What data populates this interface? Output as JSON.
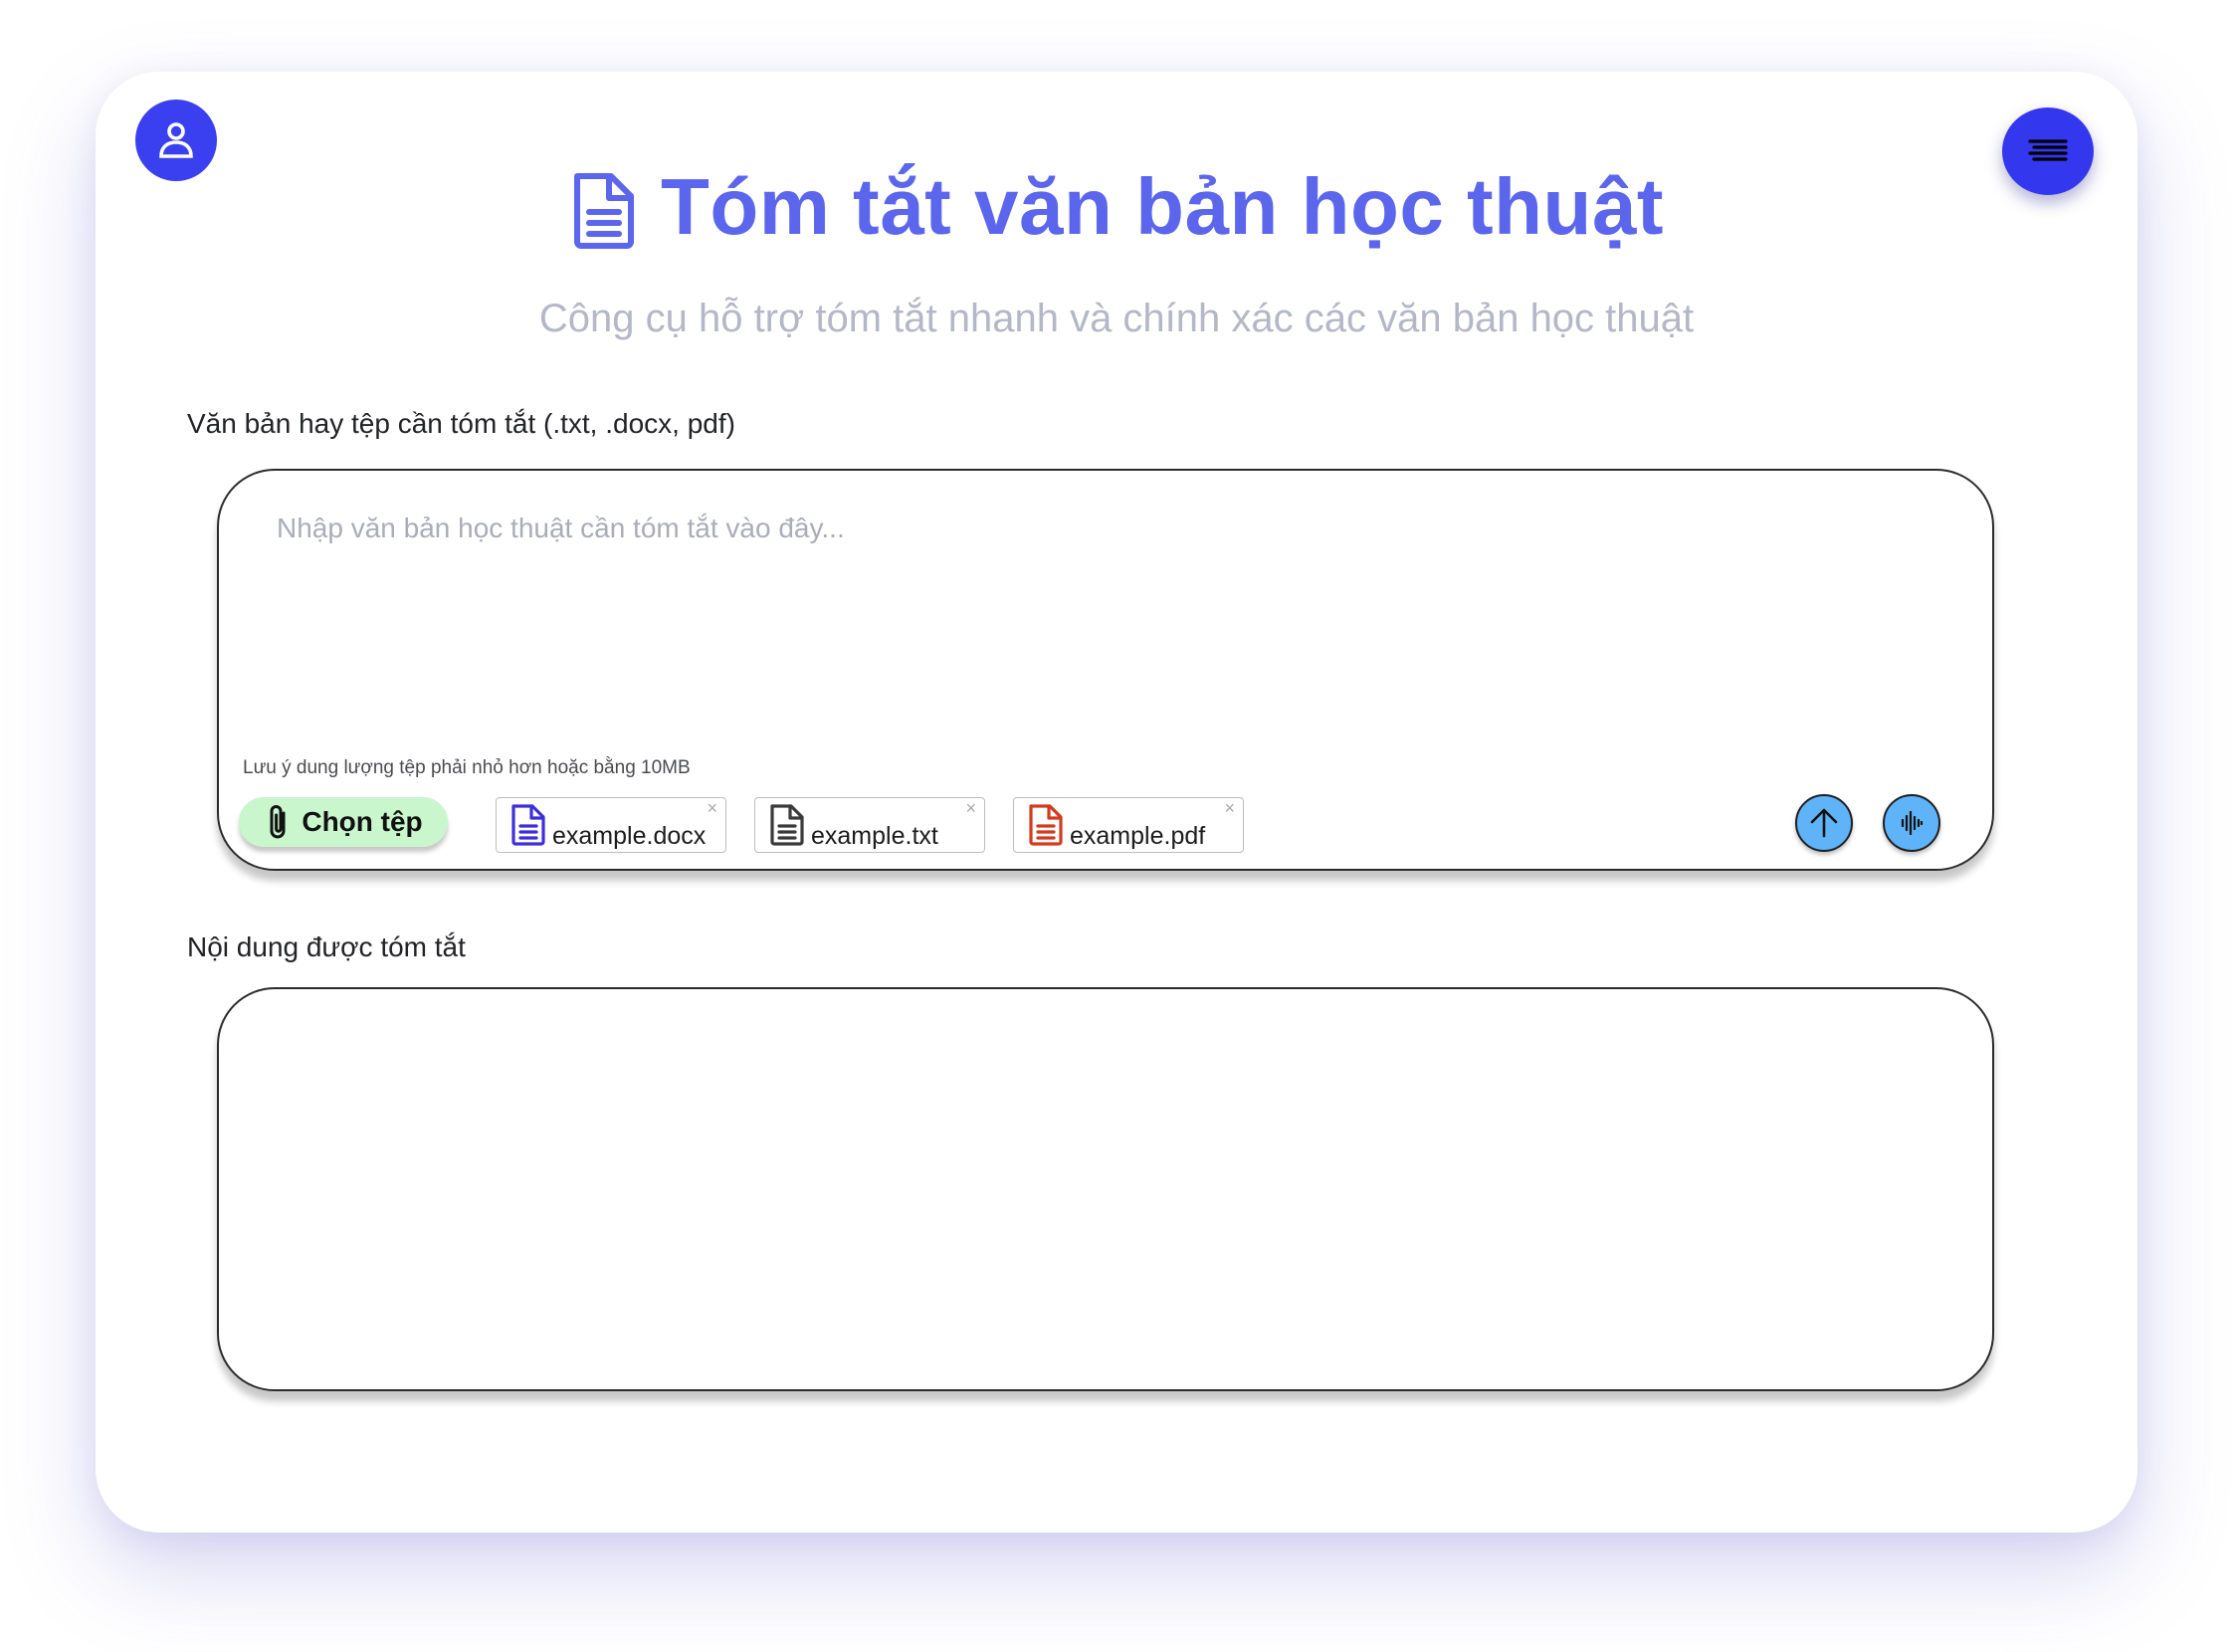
{
  "header": {
    "title": "Tóm tắt văn bản học thuật",
    "subtitle": "Công cụ hỗ trợ tóm tắt nhanh và chính xác các văn bản học thuật",
    "title_color": "#5b66ec",
    "title_icon": "document-icon"
  },
  "nav": {
    "user_icon": "user-icon",
    "menu_icon": "hamburger-menu-icon",
    "accent_color": "#3a3ff0"
  },
  "input_section": {
    "label": "Văn bản hay tệp cần tóm tắt (.txt, .docx, pdf)",
    "placeholder": "Nhập văn bản học thuật cần tóm tắt vào đây...",
    "value": "",
    "note": "Lưu ý dung lượng tệp phải nhỏ hơn hoặc bằng 10MB",
    "choose_button": {
      "label": "Chọn tệp",
      "icon": "paperclip-icon",
      "color": "#c9f6cc"
    },
    "files": [
      {
        "name": "example.docx",
        "icon": "docx-file-icon",
        "color": "#3e2fd8"
      },
      {
        "name": "example.txt",
        "icon": "txt-file-icon",
        "color": "#3a3a3a"
      },
      {
        "name": "example.pdf",
        "icon": "pdf-file-icon",
        "color": "#d13b1e"
      }
    ],
    "remove_glyph": "×",
    "upload_button_icon": "arrow-up-icon",
    "voice_button_icon": "voice-waveform-icon",
    "action_color": "#5fb3f9"
  },
  "output_section": {
    "label": "Nội dung được tóm tắt",
    "content": ""
  }
}
